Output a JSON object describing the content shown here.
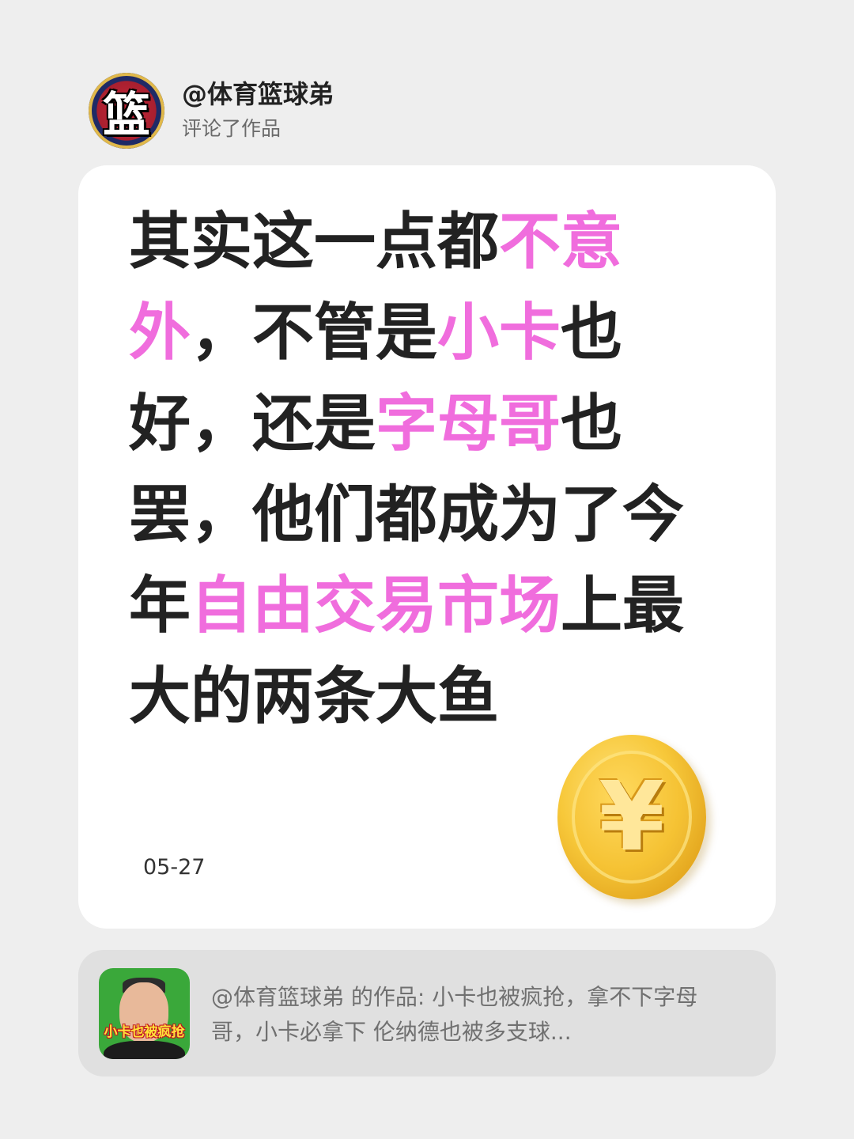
{
  "header": {
    "username": "@体育篮球弟",
    "action": "评论了作品",
    "avatar_glyph": "篮"
  },
  "comment": {
    "lines": [
      [
        {
          "text": "其实这一点都",
          "highlight": false
        },
        {
          "text": "不意",
          "highlight": true
        }
      ],
      [
        {
          "text": "外",
          "highlight": true
        },
        {
          "text": "，不管是",
          "highlight": false
        },
        {
          "text": "小卡",
          "highlight": true
        },
        {
          "text": "也",
          "highlight": false
        }
      ],
      [
        {
          "text": "好，还是",
          "highlight": false
        },
        {
          "text": "字母哥",
          "highlight": true
        },
        {
          "text": "也",
          "highlight": false
        }
      ],
      [
        {
          "text": "罢，他们都成为了今",
          "highlight": false
        }
      ],
      [
        {
          "text": "年",
          "highlight": false
        },
        {
          "text": "自由交易市场",
          "highlight": true
        },
        {
          "text": "上最",
          "highlight": false
        }
      ],
      [
        {
          "text": "大的两条大鱼",
          "highlight": false
        }
      ]
    ],
    "date": "05-27",
    "coin_icon": "yuan-coin-icon",
    "coin_symbol": "¥",
    "highlight_color": "#f06ddd",
    "text_color": "#222222"
  },
  "reference": {
    "thumbnail_caption": "小卡也被疯抢",
    "text": "@体育篮球弟 的作品: 小卡也被疯抢，拿不下字母哥，小卡必拿下 伦纳德也被多支球..."
  }
}
